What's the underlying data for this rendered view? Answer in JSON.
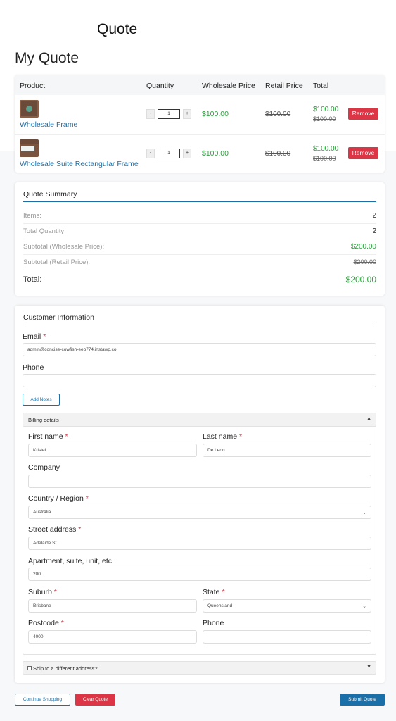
{
  "site": {
    "title": "Quote"
  },
  "page": {
    "heading": "My Quote"
  },
  "table": {
    "headers": {
      "product": "Product",
      "quantity": "Quantity",
      "wholesale": "Wholesale Price",
      "retail": "Retail Price",
      "total": "Total"
    },
    "rows": [
      {
        "name": "Wholesale Frame",
        "qty_minus": "-",
        "qty": "1",
        "qty_plus": "+",
        "wholesale": "$100.00",
        "retail": "$100.00",
        "total_new": "$100.00",
        "total_old": "$100.00",
        "remove": "Remove",
        "thumb_icon": "product-thumbnail"
      },
      {
        "name": "Wholesale Suite Rectangular Frame",
        "qty_minus": "-",
        "qty": "1",
        "qty_plus": "+",
        "wholesale": "$100.00",
        "retail": "$100.00",
        "total_new": "$100.00",
        "total_old": "$100.00",
        "remove": "Remove",
        "thumb_icon": "product-thumbnail"
      }
    ]
  },
  "summary": {
    "title": "Quote Summary",
    "rows": [
      {
        "label": "Items:",
        "value": "2"
      },
      {
        "label": "Total Quantity:",
        "value": "2"
      },
      {
        "label": "Subtotal (Wholesale Price):",
        "value": "$200.00"
      },
      {
        "label": "Subtotal (Retail Price):",
        "value": "$200.00"
      }
    ],
    "total_label": "Total:",
    "total_value": "$200.00"
  },
  "customer": {
    "title": "Customer Information",
    "email_label": "Email",
    "email_value": "admin@concise-cowfish-eeb774.instawp.co",
    "phone_label": "Phone",
    "phone_value": "",
    "add_notes": "Add Notes",
    "required_mark": "*"
  },
  "billing": {
    "title": "Billing details",
    "toggle": "▲",
    "first_name_label": "First name",
    "first_name_value": "Kristel",
    "last_name_label": "Last name",
    "last_name_value": "De Leon",
    "company_label": "Company",
    "company_value": "",
    "country_label": "Country / Region",
    "country_value": "Australia",
    "street_label": "Street address",
    "street_value": "Adelaide St",
    "apartment_label": "Apartment, suite, unit, etc.",
    "apartment_value": "200",
    "suburb_label": "Suburb",
    "suburb_value": "Brisbane",
    "state_label": "State",
    "state_value": "Queensland",
    "postcode_label": "Postcode",
    "postcode_value": "4000",
    "phone_label": "Phone",
    "phone_value": "",
    "chevron": "⌄"
  },
  "shipping": {
    "label": "Ship to a different address?",
    "toggle": "▼"
  },
  "actions": {
    "continue": "Continue Shopping",
    "clear": "Clear Quote",
    "submit": "Submit Quote"
  },
  "colors": {
    "accent": "#1a6fa8",
    "price_green": "#2e9e3e",
    "danger": "#dc3545"
  }
}
